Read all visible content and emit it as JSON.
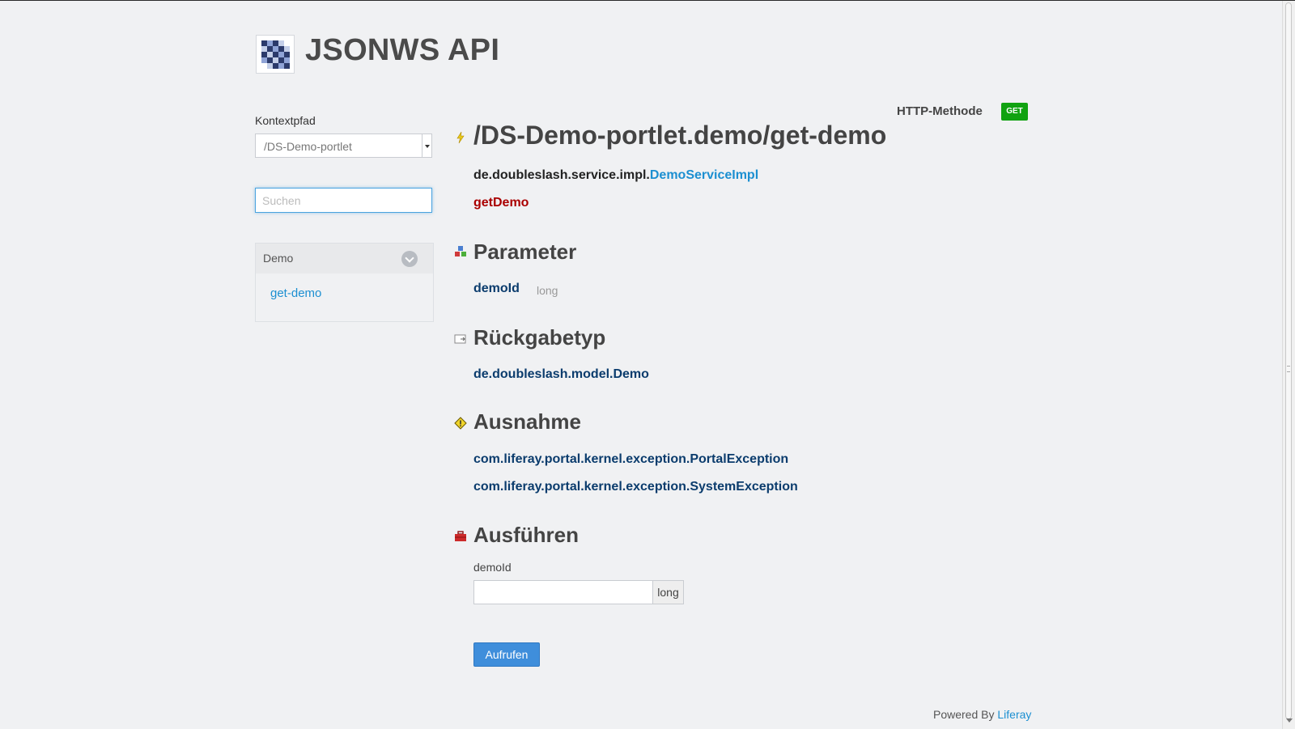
{
  "header": {
    "title": "JSONWS API"
  },
  "sidebar": {
    "context_label": "Kontextpfad",
    "context_value": "/DS-Demo-portlet",
    "search_placeholder": "Suchen",
    "group": {
      "title": "Demo",
      "items": [
        {
          "label": "get-demo"
        }
      ]
    }
  },
  "main": {
    "http_method_label": "HTTP-Methode",
    "http_method": "GET",
    "endpoint": "/DS-Demo-portlet.demo/get-demo",
    "service_package": "de.doubleslash.service.impl.",
    "service_class": "DemoServiceImpl",
    "method": "getDemo",
    "parameter_heading": "Parameter",
    "parameters": [
      {
        "name": "demoId",
        "type": "long"
      }
    ],
    "return_heading": "Rückgabetyp",
    "return_type": "de.doubleslash.model.Demo",
    "exception_heading": "Ausnahme",
    "exceptions": [
      "com.liferay.portal.kernel.exception.PortalException",
      "com.liferay.portal.kernel.exception.SystemException"
    ],
    "execute_heading": "Ausführen",
    "execute": {
      "field_label": "demoId",
      "field_type": "long",
      "button_label": "Aufrufen"
    }
  },
  "footer": {
    "prefix": "Powered By",
    "link": "Liferay"
  },
  "colors": {
    "accent": "#1c8fd1",
    "badge_get": "#11a211",
    "method": "#aa0000",
    "type": "#0b3c6d",
    "button": "#3f8edb"
  }
}
